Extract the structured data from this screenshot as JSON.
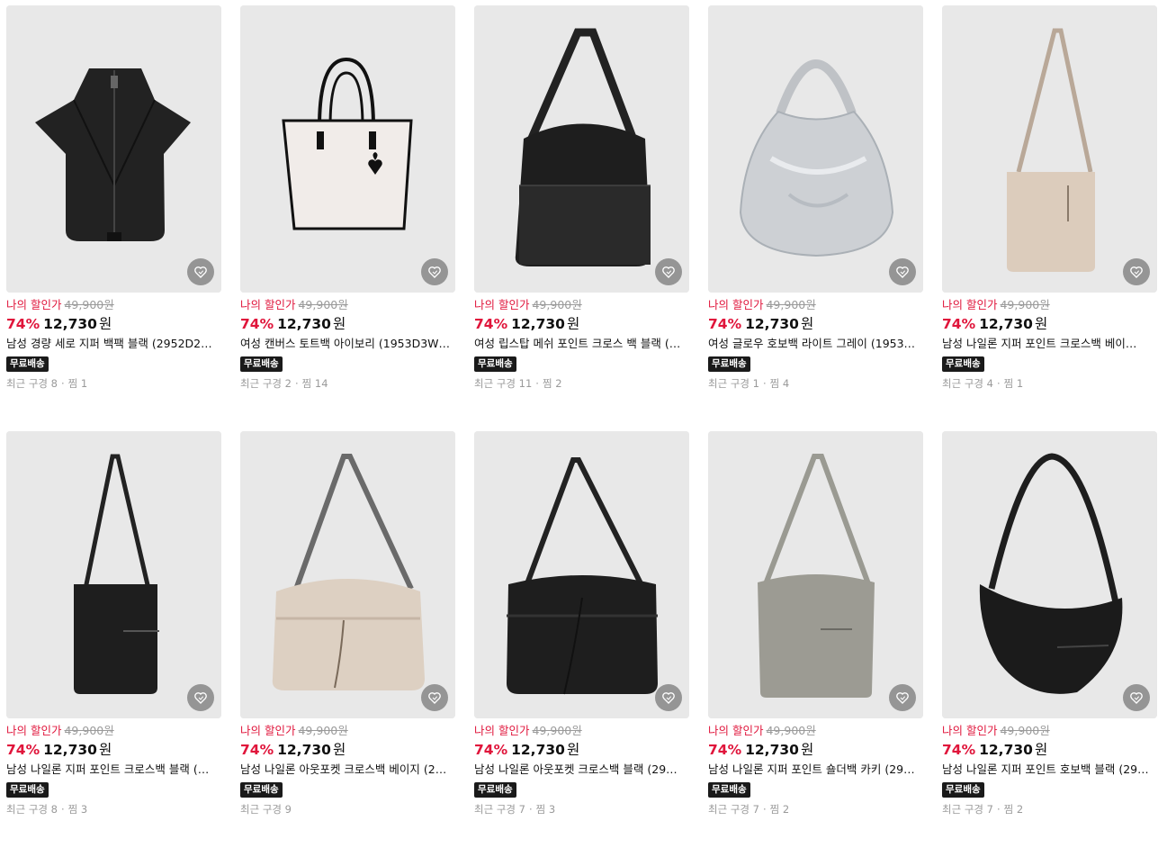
{
  "colors": {
    "accent_red": "#e0153b",
    "badge_bg": "#1a1a1a",
    "thumb_bg": "#e8e8e8",
    "muted": "#9a9a9a"
  },
  "products": [
    {
      "discount_label": "나의 할인가",
      "original_price": "49,900원",
      "discount_pct": "74%",
      "price": "12,730",
      "currency": "원",
      "name": "남성 경량 세로 지퍼 백팩 블랙 (2952D2W…",
      "badge": "무료배송",
      "recent_label": "최근 구경",
      "recent_count": "8",
      "like_label": "찜",
      "like_count": "1",
      "image": "black-backpack",
      "wishlist_icon": "heart-wishlist-icon"
    },
    {
      "discount_label": "나의 할인가",
      "original_price": "49,900원",
      "discount_pct": "74%",
      "price": "12,730",
      "currency": "원",
      "name": "여성 캔버스 토트백 아이보리 (1953D3W…",
      "badge": "무료배송",
      "recent_label": "최근 구경",
      "recent_count": "2",
      "like_label": "찜",
      "like_count": "14",
      "image": "ivory-canvas-tote",
      "wishlist_icon": "heart-wishlist-icon"
    },
    {
      "discount_label": "나의 할인가",
      "original_price": "49,900원",
      "discount_pct": "74%",
      "price": "12,730",
      "currency": "원",
      "name": "여성 립스탑 메쉬 포인트 크로스 백 블랙 (…",
      "badge": "무료배송",
      "recent_label": "최근 구경",
      "recent_count": "11",
      "like_label": "찜",
      "like_count": "2",
      "image": "black-mesh-crossbag",
      "wishlist_icon": "heart-wishlist-icon"
    },
    {
      "discount_label": "나의 할인가",
      "original_price": "49,900원",
      "discount_pct": "74%",
      "price": "12,730",
      "currency": "원",
      "name": "여성 글로우 호보백 라이트 그레이 (1953…",
      "badge": "무료배송",
      "recent_label": "최근 구경",
      "recent_count": "1",
      "like_label": "찜",
      "like_count": "4",
      "image": "silver-hobo-bag",
      "wishlist_icon": "heart-wishlist-icon"
    },
    {
      "discount_label": "나의 할인가",
      "original_price": "49,900원",
      "discount_pct": "74%",
      "price": "12,730",
      "currency": "원",
      "name": "남성 나일론 지퍼 포인트 크로스백 베이…",
      "badge": "무료배송",
      "recent_label": "최근 구경",
      "recent_count": "4",
      "like_label": "찜",
      "like_count": "1",
      "image": "beige-crossbag",
      "wishlist_icon": "heart-wishlist-icon"
    },
    {
      "discount_label": "나의 할인가",
      "original_price": "49,900원",
      "discount_pct": "74%",
      "price": "12,730",
      "currency": "원",
      "name": "남성 나일론 지퍼 포인트 크로스백 블랙 (…",
      "badge": "무료배송",
      "recent_label": "최근 구경",
      "recent_count": "8",
      "like_label": "찜",
      "like_count": "3",
      "image": "black-crossbag",
      "wishlist_icon": "heart-wishlist-icon"
    },
    {
      "discount_label": "나의 할인가",
      "original_price": "49,900원",
      "discount_pct": "74%",
      "price": "12,730",
      "currency": "원",
      "name": "남성 나일론 아웃포켓 크로스백 베이지 (2…",
      "badge": "무료배송",
      "recent_label": "최근 구경",
      "recent_count": "9",
      "like_label": "",
      "like_count": "",
      "image": "beige-outpocket-crossbag",
      "wishlist_icon": "heart-wishlist-icon"
    },
    {
      "discount_label": "나의 할인가",
      "original_price": "49,900원",
      "discount_pct": "74%",
      "price": "12,730",
      "currency": "원",
      "name": "남성 나일론 아웃포켓 크로스백 블랙 (29…",
      "badge": "무료배송",
      "recent_label": "최근 구경",
      "recent_count": "7",
      "like_label": "찜",
      "like_count": "3",
      "image": "black-outpocket-crossbag",
      "wishlist_icon": "heart-wishlist-icon"
    },
    {
      "discount_label": "나의 할인가",
      "original_price": "49,900원",
      "discount_pct": "74%",
      "price": "12,730",
      "currency": "원",
      "name": "남성 나일론 지퍼 포인트 숄더백 카키 (29…",
      "badge": "무료배송",
      "recent_label": "최근 구경",
      "recent_count": "7",
      "like_label": "찜",
      "like_count": "2",
      "image": "khaki-shoulder-bag",
      "wishlist_icon": "heart-wishlist-icon"
    },
    {
      "discount_label": "나의 할인가",
      "original_price": "49,900원",
      "discount_pct": "74%",
      "price": "12,730",
      "currency": "원",
      "name": "남성 나일론 지퍼 포인트 호보백 블랙 (29…",
      "badge": "무료배송",
      "recent_label": "최근 구경",
      "recent_count": "7",
      "like_label": "찜",
      "like_count": "2",
      "image": "black-hobo-bag",
      "wishlist_icon": "heart-wishlist-icon"
    }
  ]
}
